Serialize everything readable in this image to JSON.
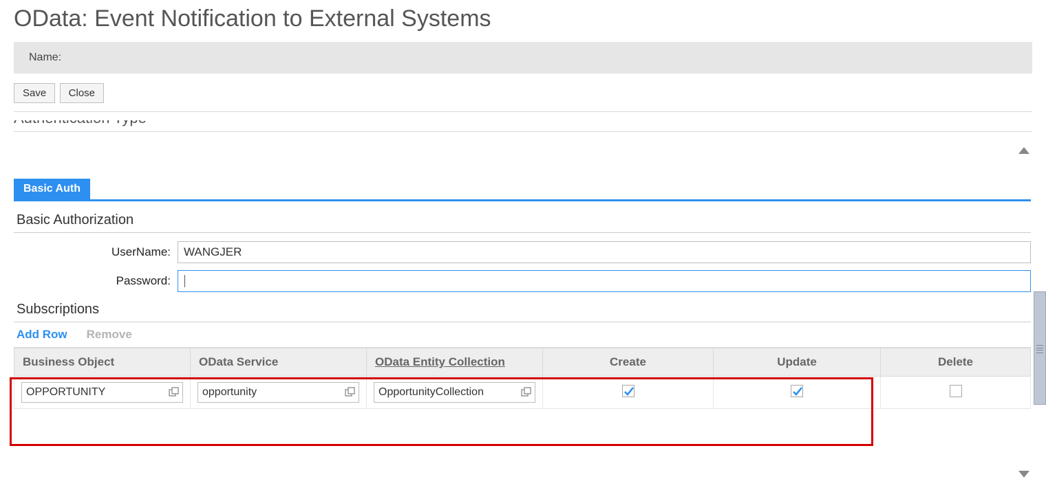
{
  "page_title": "OData: Event Notification to External Systems",
  "name_bar_label": "Name:",
  "toolbar": {
    "save_label": "Save",
    "close_label": "Close"
  },
  "cut_heading": "Authentication Type",
  "tab": {
    "basic_auth_label": "Basic Auth"
  },
  "section": {
    "basic_auth_title": "Basic Authorization",
    "subscriptions_title": "Subscriptions"
  },
  "form": {
    "username_label": "UserName:",
    "username_value": "WANGJER",
    "password_label": "Password:",
    "password_value": ""
  },
  "actions": {
    "add_row": "Add Row",
    "remove": "Remove"
  },
  "table": {
    "headers": {
      "business_object": "Business Object",
      "odata_service": "OData Service",
      "odata_entity_collection": "OData Entity Collection",
      "create": "Create",
      "update": "Update",
      "delete": "Delete"
    },
    "rows": [
      {
        "business_object": "OPPORTUNITY",
        "odata_service": "opportunity",
        "odata_entity_collection": "OpportunityCollection",
        "create": true,
        "update": true,
        "delete": false
      }
    ]
  }
}
